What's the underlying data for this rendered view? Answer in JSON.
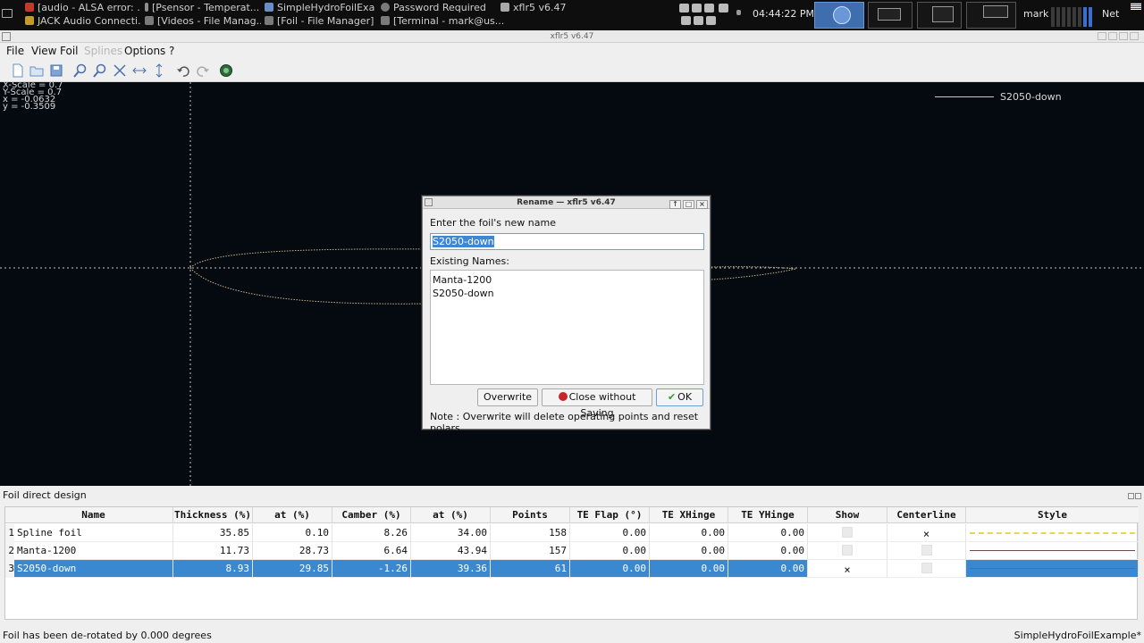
{
  "taskbar": {
    "tasks": [
      {
        "label": "[audio - ALSA error: ...",
        "color": "#c0392b"
      },
      {
        "label": "[Psensor - Temperat...",
        "color": "#8e8e8e"
      },
      {
        "label": "SimpleHydroFoilExa...",
        "color": "#6a8fc6"
      },
      {
        "label": "Password Required",
        "color": "#7a7a7a"
      },
      {
        "label": "xflr5 v6.47",
        "color": "#a8a8a8"
      },
      {
        "label": "JACK Audio Connecti...",
        "color": "#c49a28"
      },
      {
        "label": "[Videos - File Manag...",
        "color": "#7a7a7a"
      },
      {
        "label": "[Foil - File Manager]",
        "color": "#7a7a7a"
      },
      {
        "label": "[Terminal - mark@us...",
        "color": "#7a7a7a"
      }
    ],
    "clock": "04:44:22 PM",
    "user": "mark",
    "net_label": "Net"
  },
  "window": {
    "title": "xflr5 v6.47"
  },
  "menubar": {
    "items": [
      {
        "label": "File",
        "enabled": true
      },
      {
        "label": "View",
        "enabled": true
      },
      {
        "label": "Foil",
        "enabled": true
      },
      {
        "label": "Splines",
        "enabled": false
      },
      {
        "label": "Options",
        "enabled": true
      },
      {
        "label": "?",
        "enabled": true
      }
    ]
  },
  "toolbar": {
    "icons": [
      "new-icon",
      "open-icon",
      "save-icon",
      "zoom-in-icon",
      "zoom-out-icon",
      "reset-scale-icon",
      "reset-x-scale-icon",
      "reset-y-scale-icon",
      "undo-icon",
      "redo-icon",
      "render-icon"
    ]
  },
  "canvas": {
    "x_scale": "X-Scale = 0.7",
    "y_scale": "Y-Scale = 0.7",
    "x_coord": "x = -0.0632",
    "y_coord": "y = -0.3509",
    "legend_label": "S2050-down",
    "background": "#040a10"
  },
  "dialog": {
    "title": "Rename — xflr5 v6.47",
    "prompt": "Enter the foil's new name",
    "input_value": "S2050-down",
    "existing_label": "Existing Names:",
    "existing_names": [
      "Manta-1200",
      "S2050-down"
    ],
    "overwrite_label": "Overwrite",
    "close_label": "Close without Saving",
    "ok_label": "OK",
    "note": "Note : Overwrite will delete operating points and reset polars"
  },
  "dock": {
    "title": "Foil direct design",
    "columns": [
      "Name",
      "Thickness (%)",
      "at (%)",
      "Camber (%)",
      "at (%)",
      "Points",
      "TE Flap (°)",
      "TE XHinge",
      "TE YHinge",
      "Show",
      "Centerline",
      "Style"
    ],
    "rows": [
      {
        "num": "1",
        "name": "Spline foil",
        "thickness": "35.85",
        "at1": "0.10",
        "camber": "8.26",
        "at2": "34.00",
        "points": "158",
        "flap": "0.00",
        "xhinge": "0.00",
        "yhinge": "0.00",
        "show": false,
        "centerline": true,
        "style_color": "#e6d84a",
        "selected": false
      },
      {
        "num": "2",
        "name": "Manta-1200",
        "thickness": "11.73",
        "at1": "28.73",
        "camber": "6.64",
        "at2": "43.94",
        "points": "157",
        "flap": "0.00",
        "xhinge": "0.00",
        "yhinge": "0.00",
        "show": false,
        "centerline": false,
        "style_color": "#6b4a4a",
        "selected": false
      },
      {
        "num": "3",
        "name": "S2050-down",
        "thickness": "8.93",
        "at1": "29.85",
        "camber": "-1.26",
        "at2": "39.36",
        "points": "61",
        "flap": "0.00",
        "xhinge": "0.00",
        "yhinge": "0.00",
        "show": true,
        "centerline": false,
        "style_color": "#2f78c4",
        "selected": true
      }
    ]
  },
  "status": {
    "left": "Foil has been de-rotated by  0.000 degrees",
    "right": "SimpleHydroFoilExample*"
  },
  "colors": {
    "selection": "#3a88d0",
    "accent": "#6e9fd6",
    "canvas_bg": "#040a10"
  }
}
